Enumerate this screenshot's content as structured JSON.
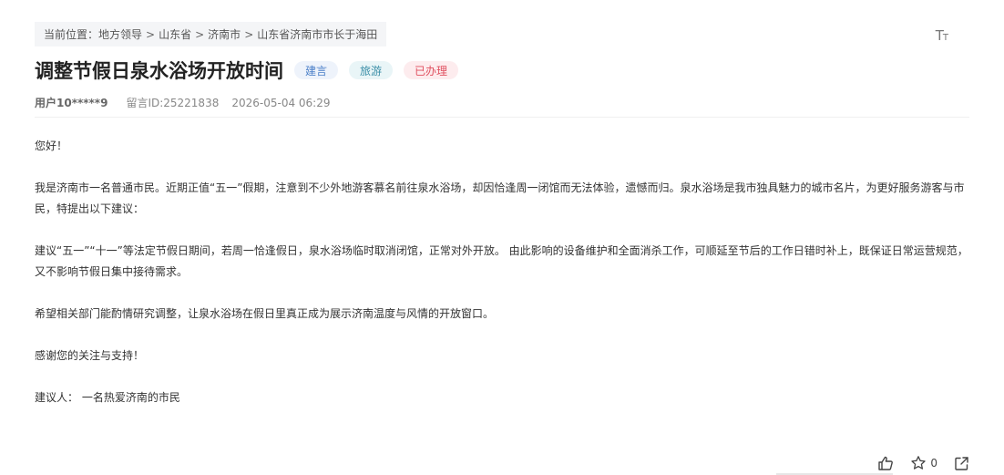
{
  "breadcrumb": {
    "prefix": "当前位置：",
    "items": [
      "地方领导",
      "山东省",
      "济南市",
      "山东省济南市市长于海田"
    ],
    "separator": ">"
  },
  "font_toggle": {
    "big": "T",
    "small": "T"
  },
  "title": "调整节假日泉水浴场开放时间",
  "tags": [
    {
      "label": "建言",
      "color": "#4a7fc8"
    },
    {
      "label": "旅游",
      "color": "#3c8fa8"
    },
    {
      "label": "已办理",
      "color": "#e05060"
    }
  ],
  "meta": {
    "user": "用户10*****9",
    "message_id": "留言ID:25221838",
    "datetime": "2026-05-04 06:29"
  },
  "content": {
    "p1": "您好！",
    "p2": "我是济南市一名普通市民。近期正值“五一”假期，注意到不少外地游客慕名前往泉水浴场，却因恰逢周一闭馆而无法体验，遗憾而归。泉水浴场是我市独具魅力的城市名片，为更好服务游客与市民，特提出以下建议：",
    "p3": "建议“五一”“十一”等法定节假日期间，若周一恰逢假日，泉水浴场临时取消闭馆，正常对外开放。 由此影响的设备维护和全面消杀工作，可顺延至节后的工作日错时补上，既保证日常运营规范，又不影响节假日集中接待需求。",
    "p4": "希望相关部门能酌情研究调整，让泉水浴场在假日里真正成为展示济南温度与风情的开放窗口。",
    "p5": "感谢您的关注与支持！",
    "p6": "建议人： 一名热爱济南的市民"
  },
  "actions": {
    "like_icon": "thumbs-up-icon",
    "favorite_icon": "star-icon",
    "favorite_count": "0",
    "share_icon": "share-icon"
  }
}
